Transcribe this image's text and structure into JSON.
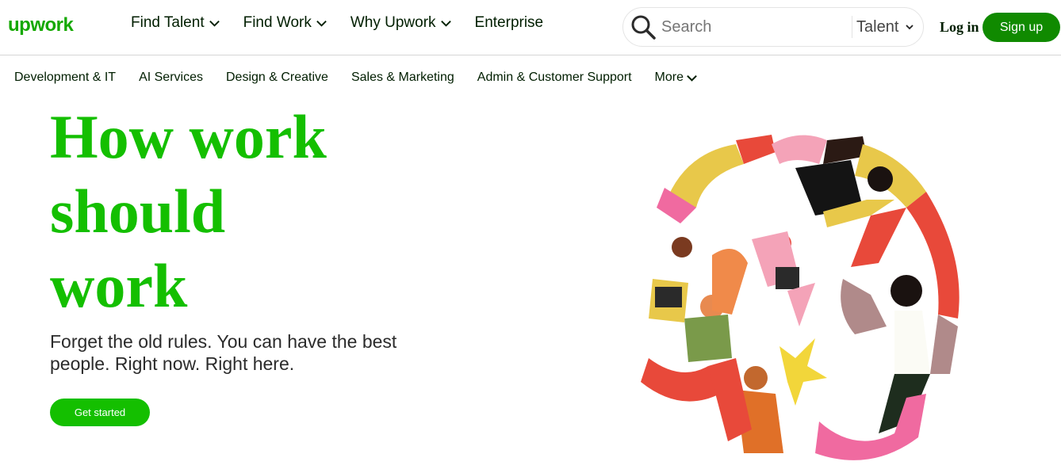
{
  "brand": {
    "logo_text": "upwork",
    "color": "#14a800"
  },
  "header": {
    "nav": [
      {
        "label": "Find Talent",
        "has_dropdown": true
      },
      {
        "label": "Find Work",
        "has_dropdown": true
      },
      {
        "label": "Why Upwork",
        "has_dropdown": true
      },
      {
        "label": "Enterprise",
        "has_dropdown": false
      }
    ],
    "search": {
      "placeholder": "Search",
      "scope": "Talent",
      "icon": "search-icon"
    },
    "login_label": "Log in",
    "signup_label": "Sign up"
  },
  "categories": [
    {
      "label": "Development & IT"
    },
    {
      "label": "AI Services"
    },
    {
      "label": "Design & Creative"
    },
    {
      "label": "Sales & Marketing"
    },
    {
      "label": "Admin & Customer Support"
    },
    {
      "label": "More",
      "has_dropdown": true
    }
  ],
  "hero": {
    "title_lines": [
      "How work",
      "should",
      "work"
    ],
    "subtitle": "Forget the old rules. You can have the best people. Right now. Right here.",
    "cta_label": "Get started",
    "accent_color": "#14bf00"
  }
}
